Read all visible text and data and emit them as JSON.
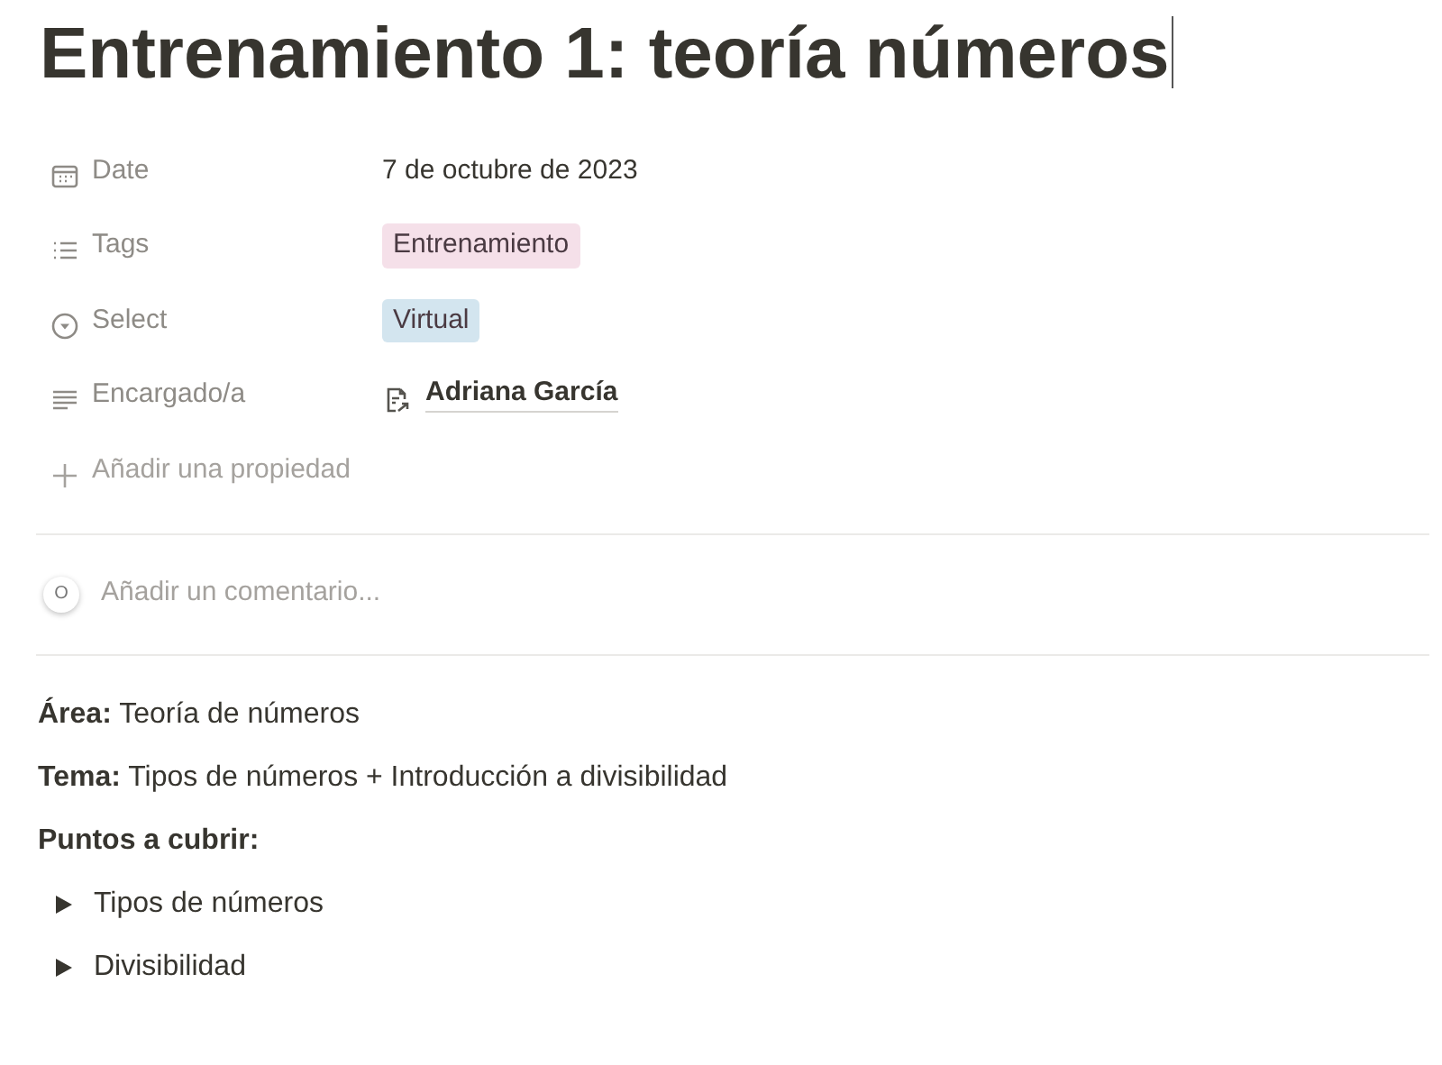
{
  "title": {
    "text": "Entrenamiento 1: teoría números",
    "cursor": true
  },
  "properties": [
    {
      "kind": "date",
      "label": "Date",
      "value": "7 de octubre de 2023"
    },
    {
      "kind": "multi_select",
      "label": "Tags",
      "tags": [
        {
          "text": "Entrenamiento",
          "color": "#f5e0e9"
        }
      ]
    },
    {
      "kind": "select",
      "label": "Select",
      "tags": [
        {
          "text": "Virtual",
          "color": "#d3e5ef"
        }
      ]
    },
    {
      "kind": "person",
      "label": "Encargado/a",
      "value": "Adriana García"
    }
  ],
  "add_property": "Añadir una propiedad",
  "comment": {
    "avatar_initial": "O",
    "placeholder": "Añadir un comentario..."
  },
  "blocks": [
    {
      "kind": "paragraph",
      "text": "**Área:** Teoría de números"
    },
    {
      "kind": "paragraph",
      "text": "**Tema:** Tipos de números + Introducción a divisibilidad"
    },
    {
      "kind": "bold_paragraph",
      "text": "Puntos a cubrir:"
    },
    {
      "kind": "toggle",
      "text": "Tipos de números",
      "expanded": false
    },
    {
      "kind": "toggle",
      "text": "Divisibilidad",
      "expanded": false
    }
  ]
}
